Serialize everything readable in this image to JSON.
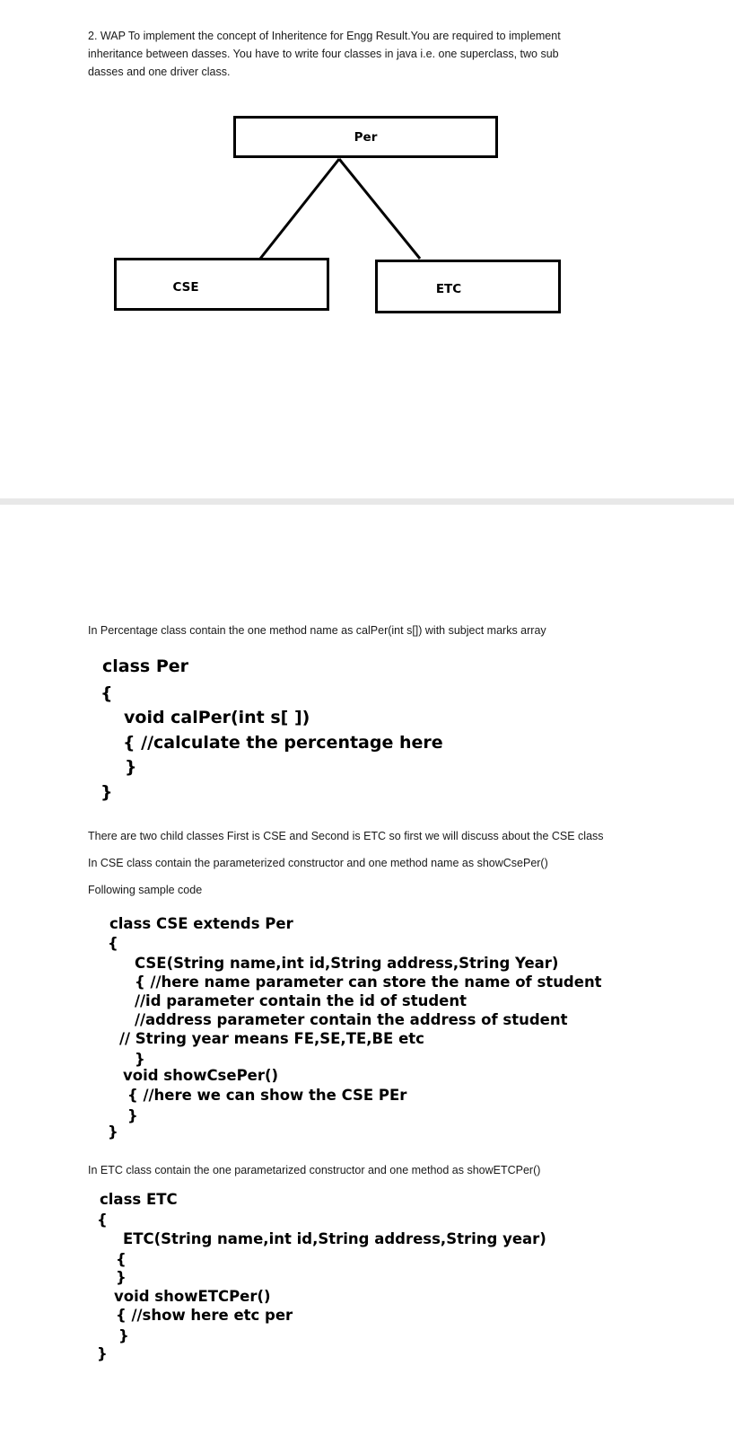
{
  "intro": {
    "line1": "2. WAP To implement the concept of Inheritence for Engg Result.You are required to implement",
    "line2": "inheritance between dasses. You have to write four classes in java i.e. one superclass, two sub",
    "line3": "dasses and one driver class."
  },
  "diagram": {
    "superclass": "Per",
    "child_left": "CSE",
    "child_right": "ETC"
  },
  "percentage_section": {
    "description": "In Percentage class contain the one method name as calPer(int s[])  with subject marks array",
    "code": [
      "class Per",
      "{",
      "void calPer(int s[ ])",
      "{ //calculate the percentage here",
      "}",
      "}"
    ]
  },
  "cse_section": {
    "description1": "There are two child classes First is CSE and Second is ETC so first we will discuss about the CSE class",
    "description2": "In CSE class contain the parameterized constructor and  one method name as showCsePer()",
    "description3": "Following sample code",
    "code": [
      "class CSE extends Per",
      "{",
      "CSE(String name,int id,String address,String Year)",
      "{ //here name parameter can store the name of student",
      "//id parameter contain the id of student",
      "//address parameter contain the address of student",
      "// String year means FE,SE,TE,BE etc",
      "}",
      "void showCsePer()",
      "{ //here we can show the CSE PEr",
      "}",
      "}"
    ]
  },
  "etc_section": {
    "description": "In ETC class contain the one parametarized constructor and one method as showETCPer()",
    "code": [
      "class ETC",
      "{",
      "ETC(String name,int id,String address,String year)",
      "{",
      "}",
      "void showETCPer()",
      "{ //show here etc per",
      "}",
      "}"
    ]
  }
}
